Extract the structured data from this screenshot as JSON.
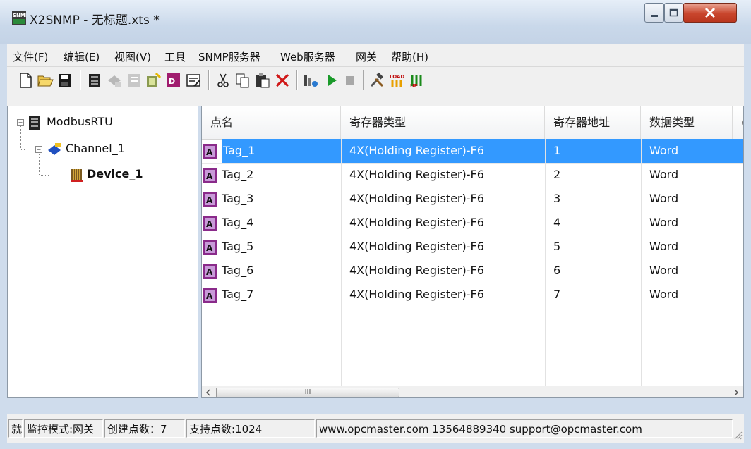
{
  "window": {
    "title": "X2SNMP - 无标题.xts *",
    "icon": "snmp-app-icon"
  },
  "menu": [
    "文件(F)",
    "编辑(E)",
    "视图(V)",
    "工具",
    "SNMP服务器",
    "Web服务器",
    "网关",
    "帮助(H)"
  ],
  "toolbar": {
    "icons": [
      "new-icon",
      "open-icon",
      "save-icon",
      "new-channel-icon",
      "new-device-icon",
      "new-tag-icon",
      "batch-tags-icon",
      "device-properties-icon",
      "properties-icon",
      "cut-icon",
      "copy-icon",
      "paste-icon",
      "delete-icon",
      "monitor-icon",
      "start-icon",
      "stop-icon",
      "tools-icon",
      "load-icon",
      "update-icon"
    ]
  },
  "tree": {
    "root": "ModbusRTU",
    "channel": "Channel_1",
    "device": "Device_1"
  },
  "list": {
    "columns": [
      "点名",
      "寄存器类型",
      "寄存器地址",
      "数据类型",
      "("
    ],
    "rows": [
      {
        "name": "Tag_1",
        "reg_type": "4X(Holding Register)-F6",
        "addr": "1",
        "dtype": "Word",
        "selected": true
      },
      {
        "name": "Tag_2",
        "reg_type": "4X(Holding Register)-F6",
        "addr": "2",
        "dtype": "Word"
      },
      {
        "name": "Tag_3",
        "reg_type": "4X(Holding Register)-F6",
        "addr": "3",
        "dtype": "Word"
      },
      {
        "name": "Tag_4",
        "reg_type": "4X(Holding Register)-F6",
        "addr": "4",
        "dtype": "Word"
      },
      {
        "name": "Tag_5",
        "reg_type": "4X(Holding Register)-F6",
        "addr": "5",
        "dtype": "Word"
      },
      {
        "name": "Tag_6",
        "reg_type": "4X(Holding Register)-F6",
        "addr": "6",
        "dtype": "Word"
      },
      {
        "name": "Tag_7",
        "reg_type": "4X(Holding Register)-F6",
        "addr": "7",
        "dtype": "Word"
      }
    ]
  },
  "scroll": {
    "thumb_grip": "III"
  },
  "status": {
    "ready": "就",
    "mode": "监控模式:网关",
    "created": "创建点数：7",
    "supported": "支持点数:1024",
    "contact": "www.opcmaster.com 13564889340 support@opcmaster.com"
  },
  "colors": {
    "selection": "#3399ff",
    "close_button": "#c9462d",
    "window_frame": "#cfdcec"
  }
}
